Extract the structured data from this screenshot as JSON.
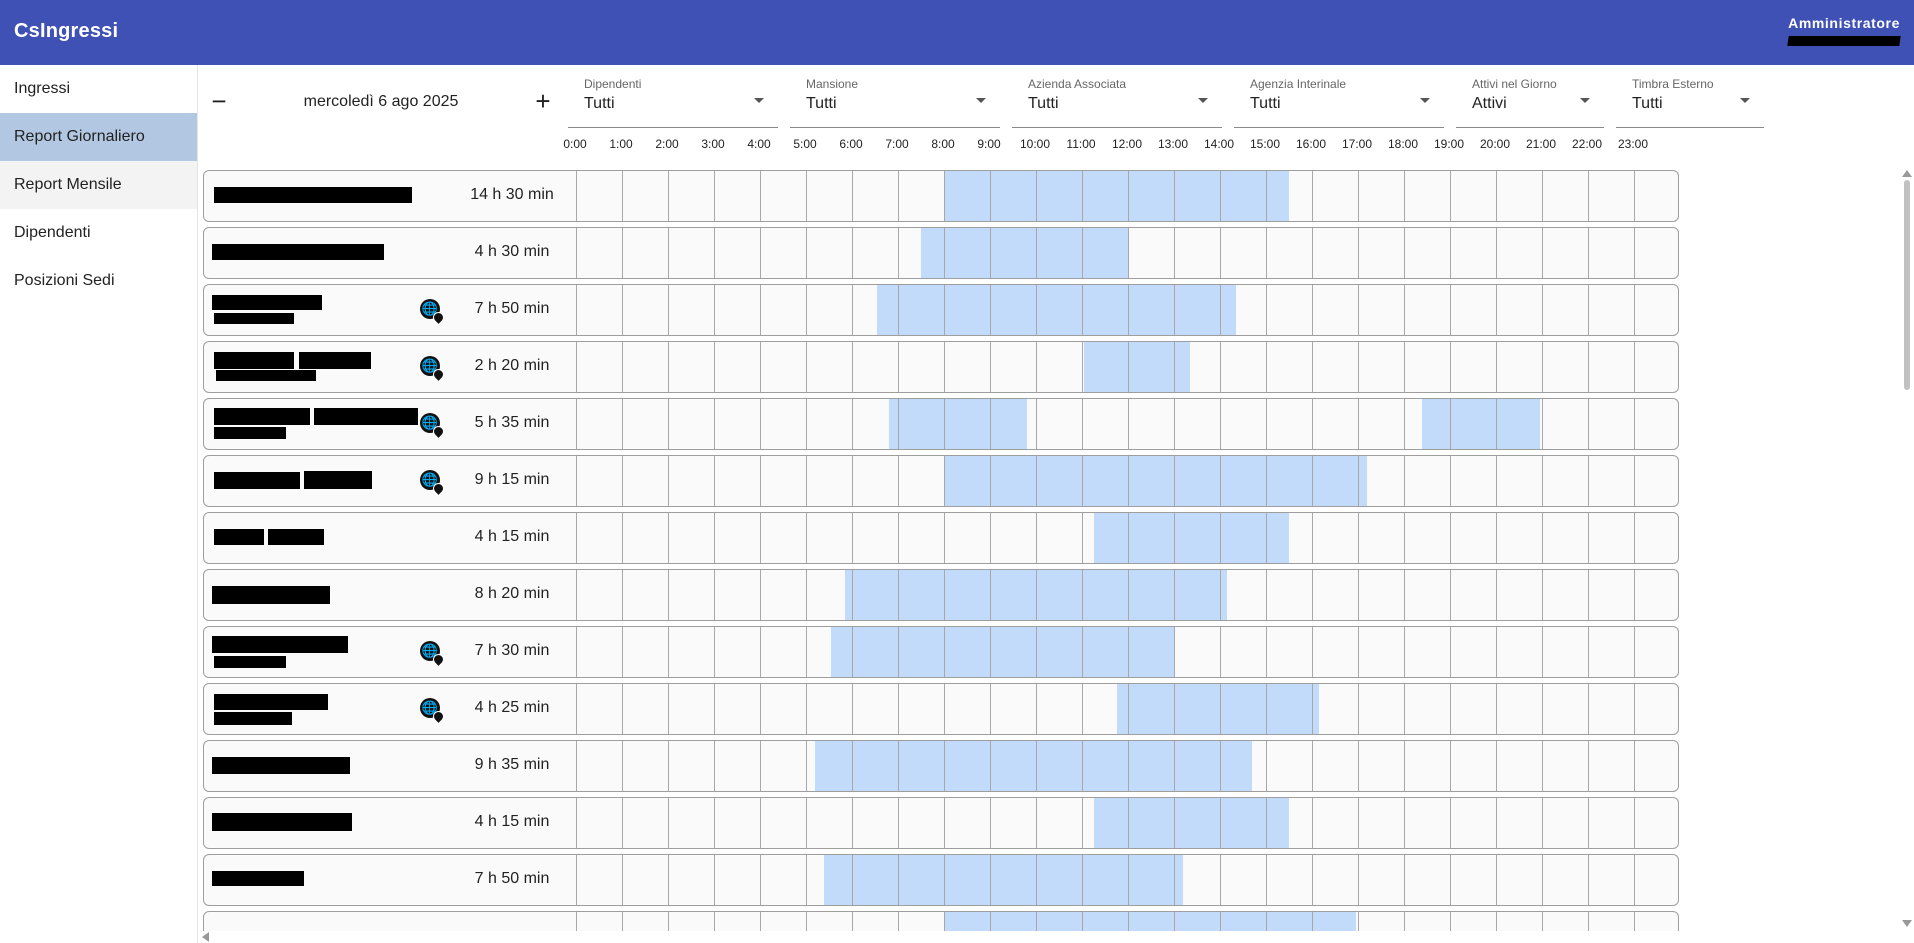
{
  "app": {
    "title": "CsIngressi",
    "user_role": "Amministratore"
  },
  "colors": {
    "header": "#3f51b5",
    "active_nav": "#b2c7e2",
    "bar": "#c2dbfb"
  },
  "sidebar": {
    "items": [
      {
        "label": "Ingressi",
        "state": "normal"
      },
      {
        "label": "Report Giornaliero",
        "state": "active"
      },
      {
        "label": "Report Mensile",
        "state": "hover"
      },
      {
        "label": "Dipendenti",
        "state": "normal"
      },
      {
        "label": "Posizioni Sedi",
        "state": "normal"
      }
    ]
  },
  "date_nav": {
    "prev": "−",
    "date": "mercoledì 6 ago 2025",
    "next": "+"
  },
  "filters": [
    {
      "label": "Dipendenti",
      "value": "Tutti"
    },
    {
      "label": "Mansione",
      "value": "Tutti"
    },
    {
      "label": "Azienda Associata",
      "value": "Tutti"
    },
    {
      "label": "Agenzia Interinale",
      "value": "Tutti"
    },
    {
      "label": "Attivi nel Giorno",
      "value": "Attivi"
    },
    {
      "label": "Timbra Esterno",
      "value": "Tutti"
    }
  ],
  "hours": [
    "0:00",
    "1:00",
    "2:00",
    "3:00",
    "4:00",
    "5:00",
    "6:00",
    "7:00",
    "8:00",
    "9:00",
    "10:00",
    "11:00",
    "12:00",
    "13:00",
    "14:00",
    "15:00",
    "16:00",
    "17:00",
    "18:00",
    "19:00",
    "20:00",
    "21:00",
    "22:00",
    "23:00"
  ],
  "rows": [
    {
      "duration": "14 h 30 min",
      "external": false,
      "intervals": [
        [
          8.0,
          15.5
        ]
      ]
    },
    {
      "duration": "4 h 30 min",
      "external": false,
      "intervals": [
        [
          7.5,
          12.0
        ]
      ]
    },
    {
      "duration": "7 h 50 min",
      "external": true,
      "intervals": [
        [
          6.55,
          14.35
        ]
      ]
    },
    {
      "duration": "2 h 20 min",
      "external": true,
      "intervals": [
        [
          11.05,
          13.35
        ]
      ]
    },
    {
      "duration": "5 h 35 min",
      "external": true,
      "intervals": [
        [
          6.8,
          9.8
        ],
        [
          18.4,
          20.95
        ]
      ]
    },
    {
      "duration": "9 h 15 min",
      "external": true,
      "intervals": [
        [
          8.0,
          17.2
        ]
      ]
    },
    {
      "duration": "4 h 15 min",
      "external": false,
      "intervals": [
        [
          11.25,
          15.5
        ]
      ]
    },
    {
      "duration": "8 h 20 min",
      "external": false,
      "intervals": [
        [
          5.85,
          14.15
        ]
      ]
    },
    {
      "duration": "7 h 30 min",
      "external": true,
      "intervals": [
        [
          5.55,
          13.0
        ]
      ]
    },
    {
      "duration": "4 h 25 min",
      "external": true,
      "intervals": [
        [
          11.75,
          16.15
        ]
      ]
    },
    {
      "duration": "9 h 35 min",
      "external": false,
      "intervals": [
        [
          5.2,
          14.7
        ]
      ]
    },
    {
      "duration": "4 h 15 min",
      "external": false,
      "intervals": [
        [
          11.25,
          15.5
        ]
      ]
    },
    {
      "duration": "7 h 50 min",
      "external": false,
      "intervals": [
        [
          5.4,
          13.2
        ]
      ]
    },
    {
      "duration": "",
      "external": false,
      "intervals": [
        [
          8.0,
          16.95
        ]
      ]
    }
  ]
}
